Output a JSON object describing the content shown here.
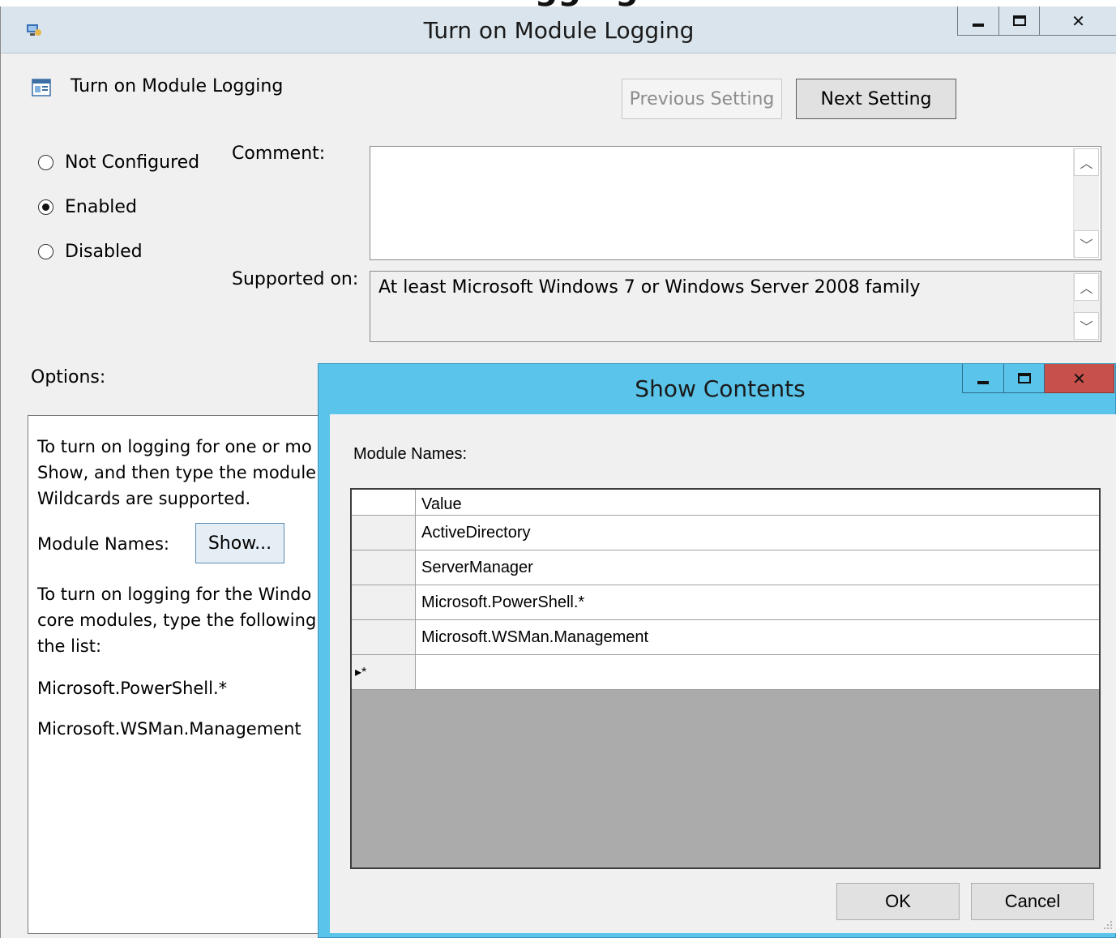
{
  "cropped_heading": "ogging",
  "main_window": {
    "title": "Turn on Module Logging",
    "setting_name": "Turn on Module Logging",
    "prev_button": "Previous Setting",
    "next_button": "Next Setting",
    "radios": [
      {
        "label": "Not Configured",
        "selected": false
      },
      {
        "label": "Enabled",
        "selected": true
      },
      {
        "label": "Disabled",
        "selected": false
      }
    ],
    "comment_label": "Comment:",
    "comment_value": "",
    "supported_label": "Supported on:",
    "supported_value": "At least Microsoft Windows 7 or Windows Server 2008 family",
    "options_label": "Options:",
    "options_panel": {
      "line1": "To turn on logging for one or mo",
      "line2": "Show, and then type the module r",
      "line3": "Wildcards are supported.",
      "module_names_label": "Module Names:",
      "show_button": "Show...",
      "line4": "To turn on logging for the Windo",
      "line5": "core modules, type the following",
      "line6": "the list:",
      "line7": "Microsoft.PowerShell.*",
      "line8": "Microsoft.WSMan.Management"
    }
  },
  "dialog": {
    "title": "Show Contents",
    "label": "Module Names:",
    "column_header": "Value",
    "rows": [
      "ActiveDirectory",
      "ServerManager",
      "Microsoft.PowerShell.*",
      "Microsoft.WSMan.Management"
    ],
    "new_row_marker": "▸*",
    "ok_button": "OK",
    "cancel_button": "Cancel"
  },
  "icons": [
    "app-icon",
    "minimize-icon",
    "maximize-icon",
    "close-icon",
    "policy-setting-icon",
    "scroll-up-icon",
    "scroll-down-icon",
    "resize-grip-icon"
  ],
  "colors": {
    "dialog_titlebar": "#5ac4ea",
    "close_button": "#c7504b",
    "main_titlebar": "#d9e4ec"
  }
}
